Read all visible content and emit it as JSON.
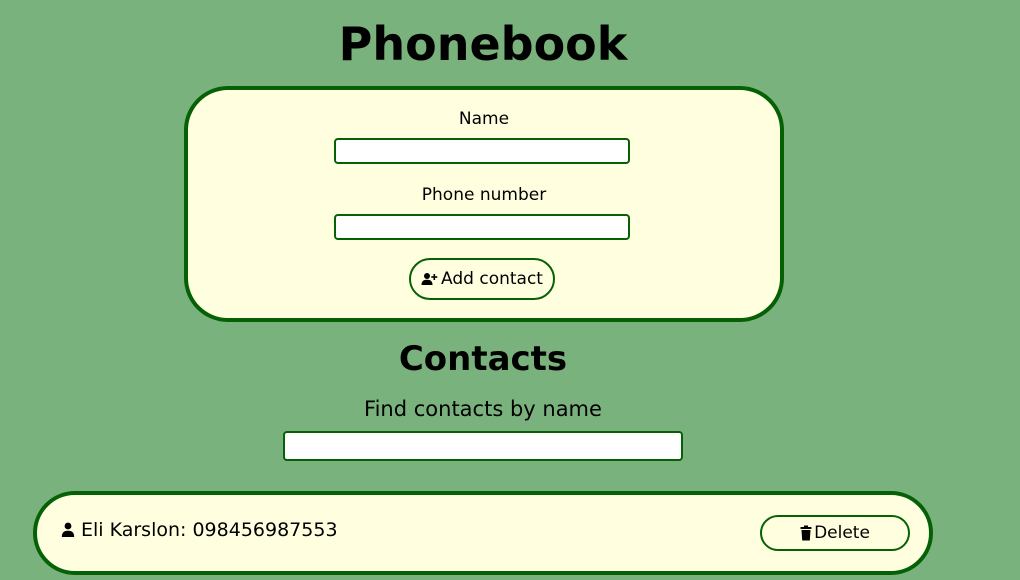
{
  "header": {
    "title": "Phonebook"
  },
  "form": {
    "name_label": "Name",
    "name_value": "",
    "phone_label": "Phone number",
    "phone_value": "",
    "add_button_label": "Add contact",
    "add_button_icon": "person-add-icon"
  },
  "contacts_section": {
    "title": "Contacts",
    "filter_label": "Find contacts by name",
    "filter_value": ""
  },
  "contacts": [
    {
      "text": "Eli Karslon: 098456987553",
      "icon": "person-icon",
      "delete_label": "Delete",
      "delete_icon": "trash-icon"
    }
  ],
  "colors": {
    "background": "#79b27d",
    "card_background": "#ffffe0",
    "accent_border": "#066106"
  }
}
